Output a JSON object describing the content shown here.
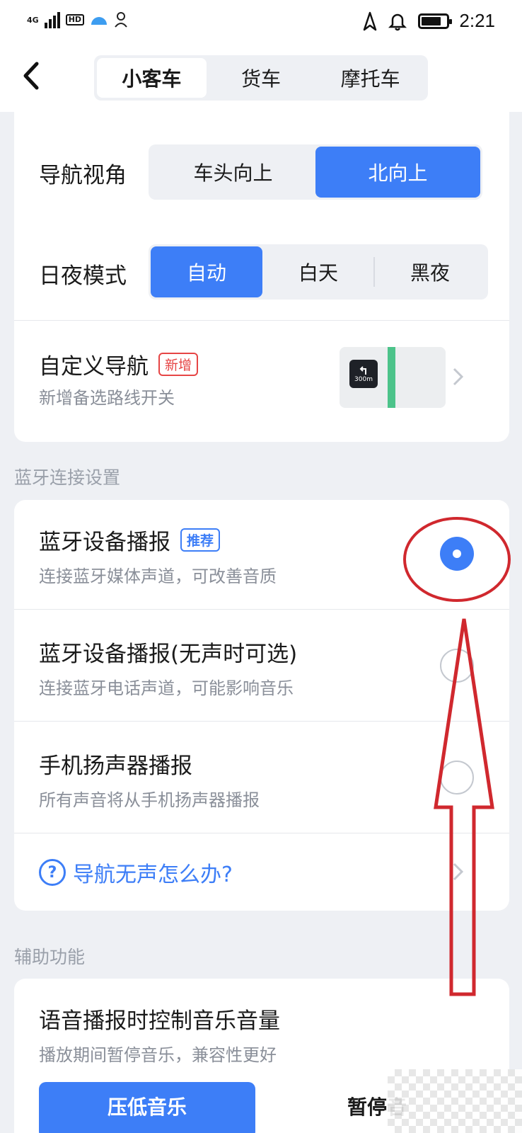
{
  "status_bar": {
    "network": "4G",
    "hd": "HD",
    "time": "2:21"
  },
  "header": {
    "tabs": [
      {
        "label": "小客车",
        "active": true
      },
      {
        "label": "货车",
        "active": false
      },
      {
        "label": "摩托车",
        "active": false
      }
    ]
  },
  "nav_view": {
    "label": "导航视角",
    "options": [
      "车头向上",
      "北向上"
    ],
    "selected": "北向上"
  },
  "day_night": {
    "label": "日夜模式",
    "options": [
      "自动",
      "白天",
      "黑夜"
    ],
    "selected": "自动"
  },
  "custom_nav": {
    "title": "自定义导航",
    "badge": "新增",
    "subtitle": "新增备选路线开关",
    "thumb_distance": "300m"
  },
  "bluetooth_section": {
    "title": "蓝牙连接设置",
    "options": [
      {
        "title": "蓝牙设备播报",
        "badge": "推荐",
        "subtitle": "连接蓝牙媒体声道，可改善音质",
        "selected": true
      },
      {
        "title": "蓝牙设备播报(无声时可选)",
        "subtitle": "连接蓝牙电话声道，可能影响音乐",
        "selected": false
      },
      {
        "title": "手机扬声器播报",
        "subtitle": "所有声音将从手机扬声器播报",
        "selected": false
      }
    ],
    "help": "导航无声怎么办?"
  },
  "assist_section": {
    "title": "辅助功能",
    "music_control": {
      "title": "语音播报时控制音乐音量",
      "subtitle": "播放期间暂停音乐，兼容性更好",
      "options": [
        "压低音乐",
        "暂停音"
      ],
      "selected": "压低音乐"
    }
  },
  "colors": {
    "accent": "#3d7ef7",
    "badge_new": "#e64545",
    "annotation": "#d0282e"
  }
}
